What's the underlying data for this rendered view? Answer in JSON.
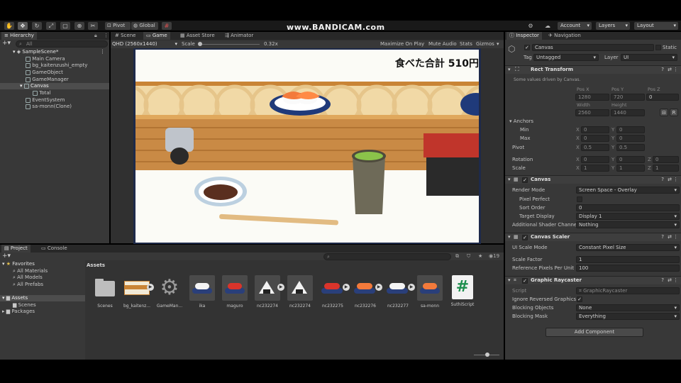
{
  "toolbar": {
    "pivot_label": "Pivot",
    "global_label": "Global",
    "watermark": "www.BANDICAM.com",
    "account_label": "Account",
    "layers_label": "Layers",
    "layout_label": "Layout"
  },
  "hierarchy": {
    "tab_label": "Hierarchy",
    "search_placeholder": "All",
    "scene_name": "SampleScene*",
    "items": [
      "Main Camera",
      "bg_kaitenzushi_empty",
      "GameObject",
      "GameManager",
      "Canvas",
      "Total",
      "EventSystem",
      "sa-monn(Clone)"
    ]
  },
  "center_tabs": [
    "Scene",
    "Game",
    "Asset Store",
    "Animator"
  ],
  "game_toolbar": {
    "resolution": "QHD (2560x1440)",
    "scale_label": "Scale",
    "scale_value": "0.32x",
    "maximize": "Maximize On Play",
    "mute": "Mute Audio",
    "stats": "Stats",
    "gizmos": "Gizmos"
  },
  "game_view": {
    "score_text": "食べた合計 510円"
  },
  "inspector": {
    "tab_inspector": "Inspector",
    "tab_navigation": "Navigation",
    "object_name": "Canvas",
    "static_label": "Static",
    "tag_label": "Tag",
    "tag_value": "Untagged",
    "layer_label": "Layer",
    "layer_value": "UI",
    "rect": {
      "title": "Rect Transform",
      "note": "Some values driven by Canvas.",
      "posx_label": "Pos X",
      "posy_label": "Pos Y",
      "posz_label": "Pos Z",
      "posx": "1280",
      "posy": "720",
      "posz": "0",
      "width_label": "Width",
      "height_label": "Height",
      "width": "2560",
      "height": "1440",
      "anchors_label": "Anchors",
      "min_label": "Min",
      "max_label": "Max",
      "min_x": "0",
      "min_y": "0",
      "max_x": "0",
      "max_y": "0",
      "pivot_label": "Pivot",
      "pivot_x": "0.5",
      "pivot_y": "0.5",
      "rotation_label": "Rotation",
      "rot_x": "0",
      "rot_y": "0",
      "rot_z": "0",
      "scale_label": "Scale",
      "scale_x": "1",
      "scale_y": "1",
      "scale_z": "1",
      "x": "X",
      "y": "Y",
      "z": "Z"
    },
    "canvas": {
      "title": "Canvas",
      "render_mode_label": "Render Mode",
      "render_mode": "Screen Space - Overlay",
      "pixel_perfect_label": "Pixel Perfect",
      "sort_order_label": "Sort Order",
      "sort_order": "0",
      "target_display_label": "Target Display",
      "target_display": "Display 1",
      "shader_label": "Additional Shader Channel",
      "shader_value": "Nothing"
    },
    "scaler": {
      "title": "Canvas Scaler",
      "ui_scale_label": "UI Scale Mode",
      "ui_scale": "Constant Pixel Size",
      "scale_factor_label": "Scale Factor",
      "scale_factor": "1",
      "ref_ppu_label": "Reference Pixels Per Unit",
      "ref_ppu": "100"
    },
    "raycaster": {
      "title": "Graphic Raycaster",
      "script_label": "Script",
      "script_value": "GraphicRaycaster",
      "ignore_label": "Ignore Reversed Graphics",
      "blocking_objects_label": "Blocking Objects",
      "blocking_objects": "None",
      "blocking_mask_label": "Blocking Mask",
      "blocking_mask": "Everything"
    },
    "add_component": "Add Component"
  },
  "project": {
    "tab_project": "Project",
    "tab_console": "Console",
    "favorites_label": "Favorites",
    "favorites": [
      "All Materials",
      "All Models",
      "All Prefabs"
    ],
    "assets_label": "Assets",
    "assets_children": [
      "Scenes",
      "Packages"
    ],
    "breadcrumb": "Assets",
    "count": "19",
    "assets": [
      "Scenes",
      "bg_kaitenz...",
      "GameMan...",
      "ika",
      "maguro",
      "nc232274",
      "nc232274",
      "nc232275",
      "nc232276",
      "nc232277",
      "sa-monn",
      "SuthiScript"
    ]
  },
  "colors": {
    "editor_bg": "#383838",
    "game_frame": "#1e2a4a",
    "belt_orange": "#c98436",
    "table_white": "#fbfbf6"
  }
}
